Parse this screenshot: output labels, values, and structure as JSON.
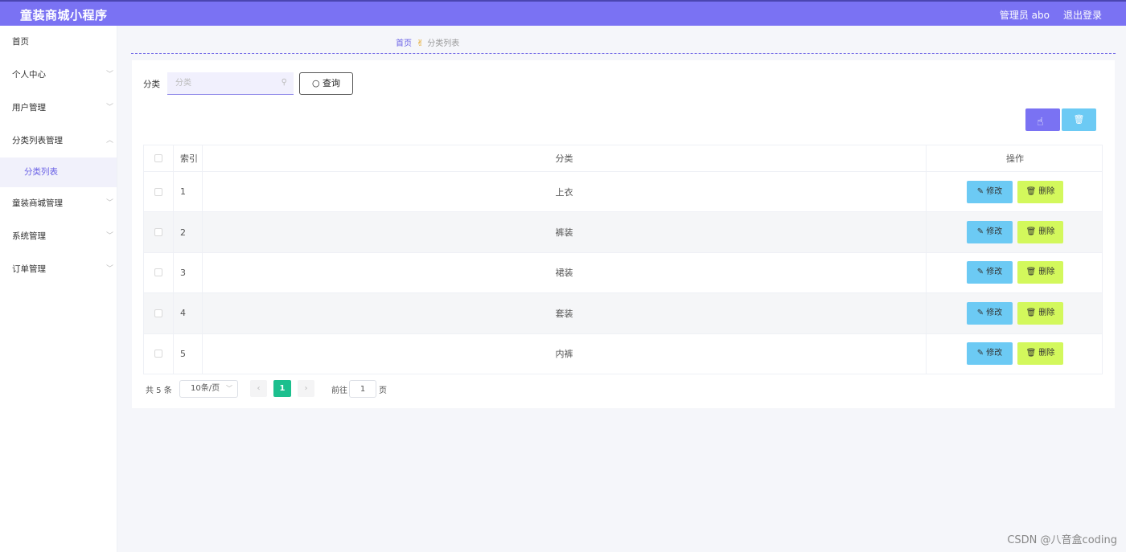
{
  "header": {
    "title": "童装商城小程序",
    "user": "管理员 abo",
    "logout": "退出登录"
  },
  "sidebar": {
    "items": [
      {
        "label": "首页"
      },
      {
        "label": "个人中心"
      },
      {
        "label": "用户管理"
      },
      {
        "label": "分类列表管理"
      },
      {
        "label": "童装商城管理"
      },
      {
        "label": "系统管理"
      },
      {
        "label": "订单管理"
      }
    ],
    "sub_active": "分类列表"
  },
  "breadcrumb": {
    "home": "首页",
    "current": "分类列表"
  },
  "search": {
    "label": "分类",
    "placeholder": "分类",
    "button": "查询"
  },
  "table": {
    "headers": {
      "index": "索引",
      "category": "分类",
      "operation": "操作"
    },
    "rows": [
      {
        "index": "1",
        "category": "上衣"
      },
      {
        "index": "2",
        "category": "裤装"
      },
      {
        "index": "3",
        "category": "裙装"
      },
      {
        "index": "4",
        "category": "套装"
      },
      {
        "index": "5",
        "category": "内裤"
      }
    ],
    "edit_label": "修改",
    "delete_label": "删除"
  },
  "pagination": {
    "total": "共 5 条",
    "page_size": "10条/页",
    "current": "1",
    "goto_prefix": "前往",
    "goto_value": "1",
    "goto_suffix": "页"
  },
  "watermark": "CSDN @八音盒coding",
  "colors": {
    "accent": "#7a72f3",
    "edit": "#6ccaf4",
    "delete": "#d3f85c",
    "page_active": "#1cbf8e"
  }
}
